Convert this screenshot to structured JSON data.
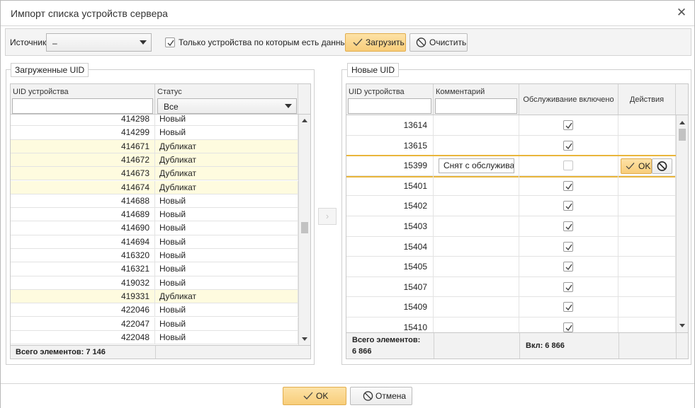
{
  "dialog": {
    "title": "Импорт списка устройств сервера",
    "close_glyph": "✕"
  },
  "toolbar": {
    "source_label": "Источник",
    "source_value": "–",
    "only_with_data_label": "Только устройства по которым есть данные",
    "only_with_data_checked": true,
    "load_label": "Загрузить",
    "clear_label": "Очистить"
  },
  "loaded": {
    "legend": "Загруженные UID",
    "col_uid": "UID устройства",
    "col_status": "Статус",
    "status_filter": "Все",
    "rows": [
      {
        "uid": "414298",
        "status": "Новый",
        "dup": false
      },
      {
        "uid": "414299",
        "status": "Новый",
        "dup": false
      },
      {
        "uid": "414671",
        "status": "Дубликат",
        "dup": true
      },
      {
        "uid": "414672",
        "status": "Дубликат",
        "dup": true
      },
      {
        "uid": "414673",
        "status": "Дубликат",
        "dup": true
      },
      {
        "uid": "414674",
        "status": "Дубликат",
        "dup": true
      },
      {
        "uid": "414688",
        "status": "Новый",
        "dup": false
      },
      {
        "uid": "414689",
        "status": "Новый",
        "dup": false
      },
      {
        "uid": "414690",
        "status": "Новый",
        "dup": false
      },
      {
        "uid": "414694",
        "status": "Новый",
        "dup": false
      },
      {
        "uid": "416320",
        "status": "Новый",
        "dup": false
      },
      {
        "uid": "416321",
        "status": "Новый",
        "dup": false
      },
      {
        "uid": "419032",
        "status": "Новый",
        "dup": false
      },
      {
        "uid": "419331",
        "status": "Дубликат",
        "dup": true
      },
      {
        "uid": "422046",
        "status": "Новый",
        "dup": false
      },
      {
        "uid": "422047",
        "status": "Новый",
        "dup": false
      },
      {
        "uid": "422048",
        "status": "Новый",
        "dup": false
      }
    ],
    "footer_total": "Всего элементов: 7 146"
  },
  "transfer_glyph": "›",
  "newuids": {
    "legend": "Новые UID",
    "col_uid": "UID устройства",
    "col_comment": "Комментарий",
    "col_service": "Обслуживание включено",
    "col_actions": "Действия",
    "rows": [
      {
        "uid": "13614",
        "service": true
      },
      {
        "uid": "13615",
        "service": true
      },
      {
        "uid": "15399",
        "service": false,
        "editing": true,
        "comment": "Снят с обслуживани"
      },
      {
        "uid": "15401",
        "service": true
      },
      {
        "uid": "15402",
        "service": true
      },
      {
        "uid": "15403",
        "service": true
      },
      {
        "uid": "15404",
        "service": true
      },
      {
        "uid": "15405",
        "service": true
      },
      {
        "uid": "15407",
        "service": true
      },
      {
        "uid": "15409",
        "service": true
      },
      {
        "uid": "15410",
        "service": true
      }
    ],
    "row_ok_label": "OK",
    "footer_total_line1": "Всего элементов:",
    "footer_total_line2": "6 866",
    "footer_enabled": "Вкл: 6 866"
  },
  "bottom": {
    "ok_label": "OK",
    "cancel_label": "Отмена"
  },
  "colors": {
    "accent_yellow": "#f8cd7a",
    "duplicate_row_bg": "#fefbdf",
    "edit_row_border": "#e9b53b"
  },
  "icons": {
    "check": "check-icon",
    "cancel": "ban-icon",
    "dropdown": "triangle-down-icon"
  }
}
